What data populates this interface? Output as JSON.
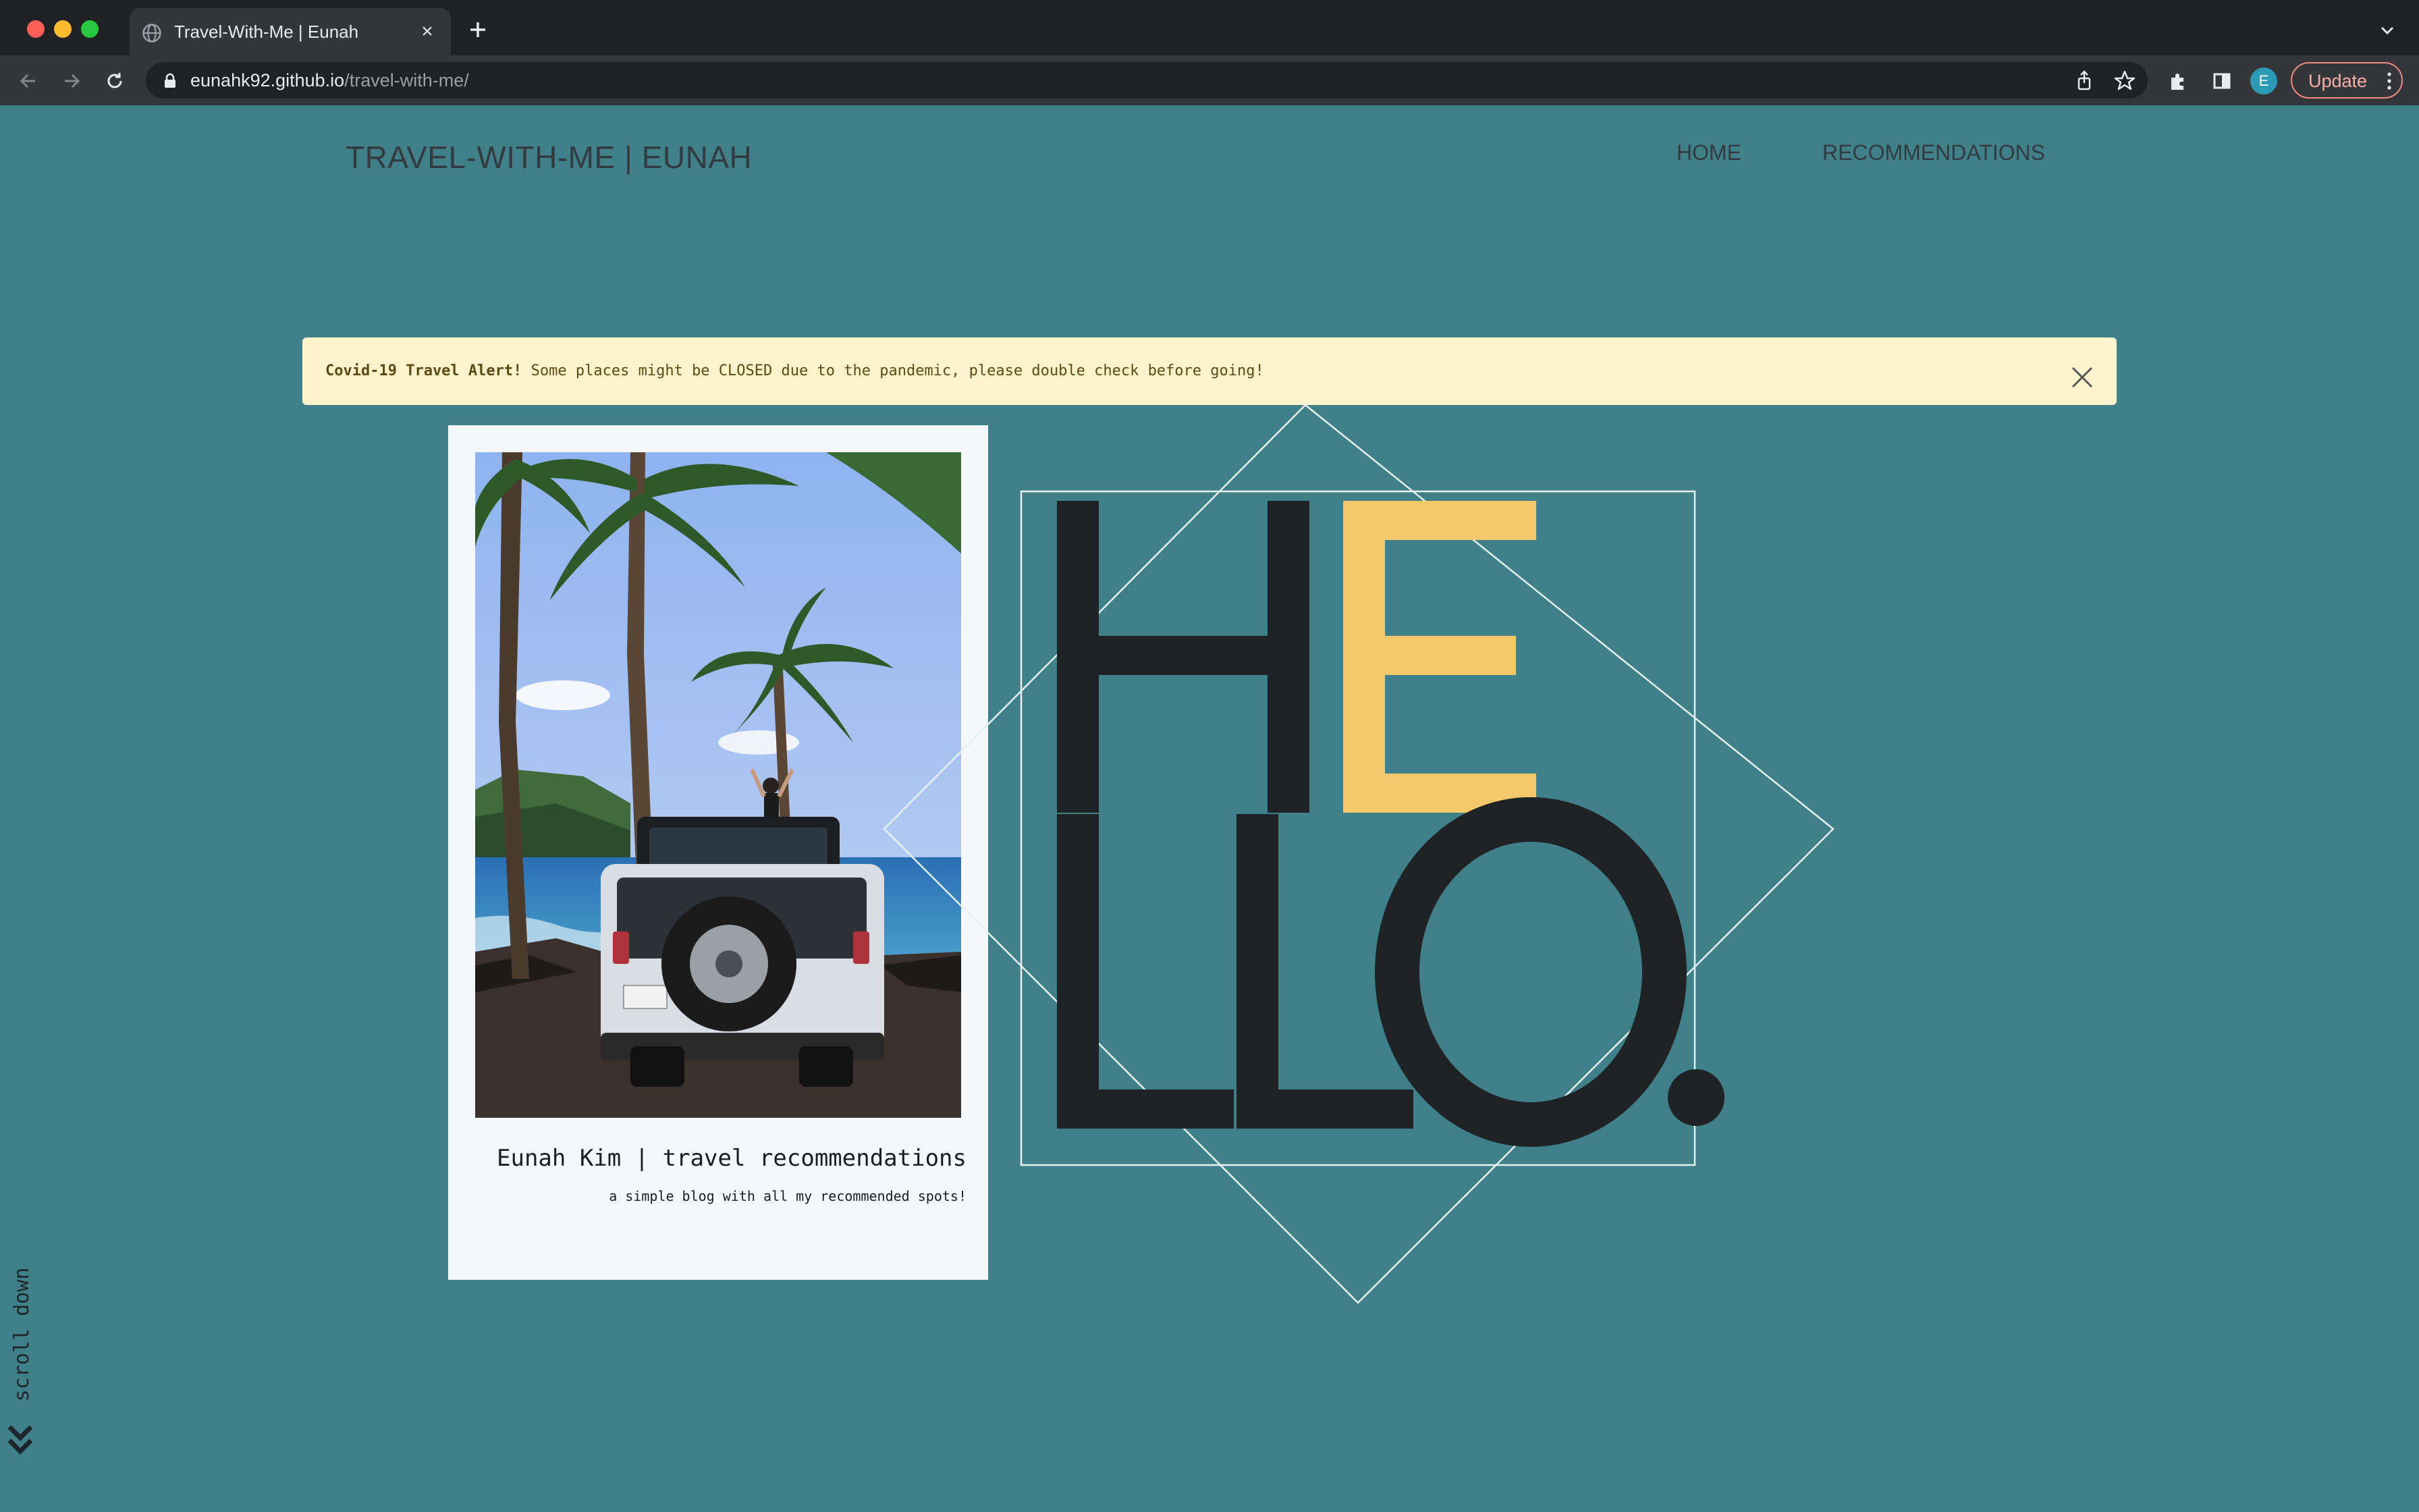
{
  "browser": {
    "tab_title": "Travel-With-Me | Eunah",
    "tab_close": "×",
    "url_host": "eunahk92.github.io",
    "url_path": "/travel-with-me/",
    "avatar_letter": "E",
    "update_label": "Update",
    "icons": [
      "globe-icon",
      "close-icon",
      "new-tab-icon",
      "tab-list-chevron-icon",
      "back-icon",
      "forward-icon",
      "reload-icon",
      "lock-icon",
      "share-icon",
      "bookmark-star-icon",
      "extensions-icon",
      "side-panel-icon",
      "kebab-menu-icon"
    ],
    "colors": {
      "frame": "#202124",
      "toolbar": "#35363a",
      "update_outline": "#f28b82"
    }
  },
  "site": {
    "title": "TRAVEL-WITH-ME | EUNAH",
    "nav": [
      {
        "label": "HOME"
      },
      {
        "label": "RECOMMENDATIONS"
      }
    ]
  },
  "alert": {
    "strong": "Covid-19 Travel Alert!",
    "text": " Some places might be CLOSED due to the pandemic, please double check before going!",
    "close_icon": "close-icon"
  },
  "card": {
    "title": "Eunah Kim | travel recommendations",
    "subtitle": "a simple blog with all my recommended spots!",
    "photo_alt": "photo-palm-trees-jeep"
  },
  "hero": {
    "letters": [
      "H",
      "E",
      "L",
      "L",
      "O",
      "."
    ],
    "accent_letter": "E"
  },
  "scroll_hint": {
    "label": "scroll down",
    "icon": "double-chevron-down-icon"
  },
  "colors": {
    "background": "#408189",
    "text_dark": "#1f2326",
    "accent": "#f4c96b",
    "alert_bg": "#fff3cd",
    "card_bg": "#f5f7fa"
  }
}
